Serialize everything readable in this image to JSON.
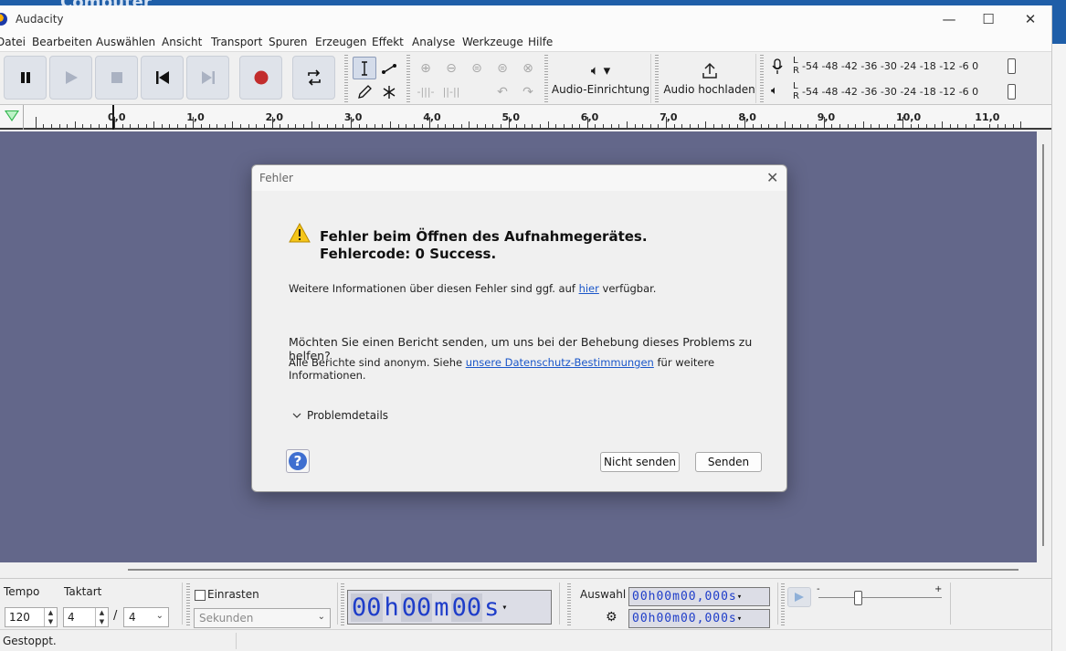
{
  "desktop": {
    "text": "Computer"
  },
  "window": {
    "title": "Audacity",
    "minimize": "—",
    "maximize": "☐",
    "close": "✕"
  },
  "menu": [
    "Datei",
    "Bearbeiten",
    "Auswählen",
    "Ansicht",
    "Transport",
    "Spuren",
    "Erzeugen",
    "Effekt",
    "Analyse",
    "Werkzeuge",
    "Hilfe"
  ],
  "toolbar": {
    "audio_setup_label": "Audio-Einrichtung",
    "upload_label": "Audio hochladen",
    "meter_scale": "-54  -48  -42  -36  -30  -24  -18  -12   -6   0",
    "meter_channels": "L\nR"
  },
  "ruler": {
    "labels": [
      "0,0",
      "1,0",
      "2,0",
      "3,0",
      "4,0",
      "5,0",
      "6,0",
      "7,0",
      "8,0",
      "9,0",
      "10,0",
      "11,0"
    ]
  },
  "bottom": {
    "tempo_label": "Tempo",
    "tempo_value": "120",
    "time_sig_label": "Taktart",
    "time_sig_num": "4",
    "time_sig_sep": "/",
    "time_sig_den": "4",
    "snap_label": "Einrasten",
    "snap_unit": "Sekunden",
    "time_display": {
      "h": "00",
      "m": "00",
      "s": "00",
      "uh": "h",
      "um": "m",
      "us": "s"
    },
    "selection_label": "Auswahl",
    "sel_start": "00h00m00,000s",
    "sel_end": "00h00m00,000s",
    "speed_minus": "-",
    "speed_plus": "+"
  },
  "status": {
    "text": "Gestoppt."
  },
  "dialog": {
    "title": "Fehler",
    "heading_line1": "Fehler beim Öffnen des Aufnahmegerätes.",
    "heading_line2": "Fehlercode: 0 Success.",
    "info_prefix": "Weitere Informationen über diesen Fehler sind ggf. auf ",
    "info_link": "hier",
    "info_suffix": " verfügbar.",
    "question": "Möchten Sie einen Bericht senden, um uns bei der Behebung dieses Problems zu helfen?",
    "anon_prefix": "Alle Berichte sind anonym. Siehe ",
    "anon_link": "unsere Datenschutz-Bestimmungen",
    "anon_suffix": " für weitere Informationen.",
    "details_label": "Problemdetails",
    "help_label": "?",
    "btn_no_send": "Nicht senden",
    "btn_send": "Senden"
  },
  "colors": {
    "track_bg": "#63678a",
    "record_red": "#c22c2c",
    "time_digits": "#1e3dc9",
    "link": "#1a56c9",
    "play_head": "#2db34a"
  }
}
